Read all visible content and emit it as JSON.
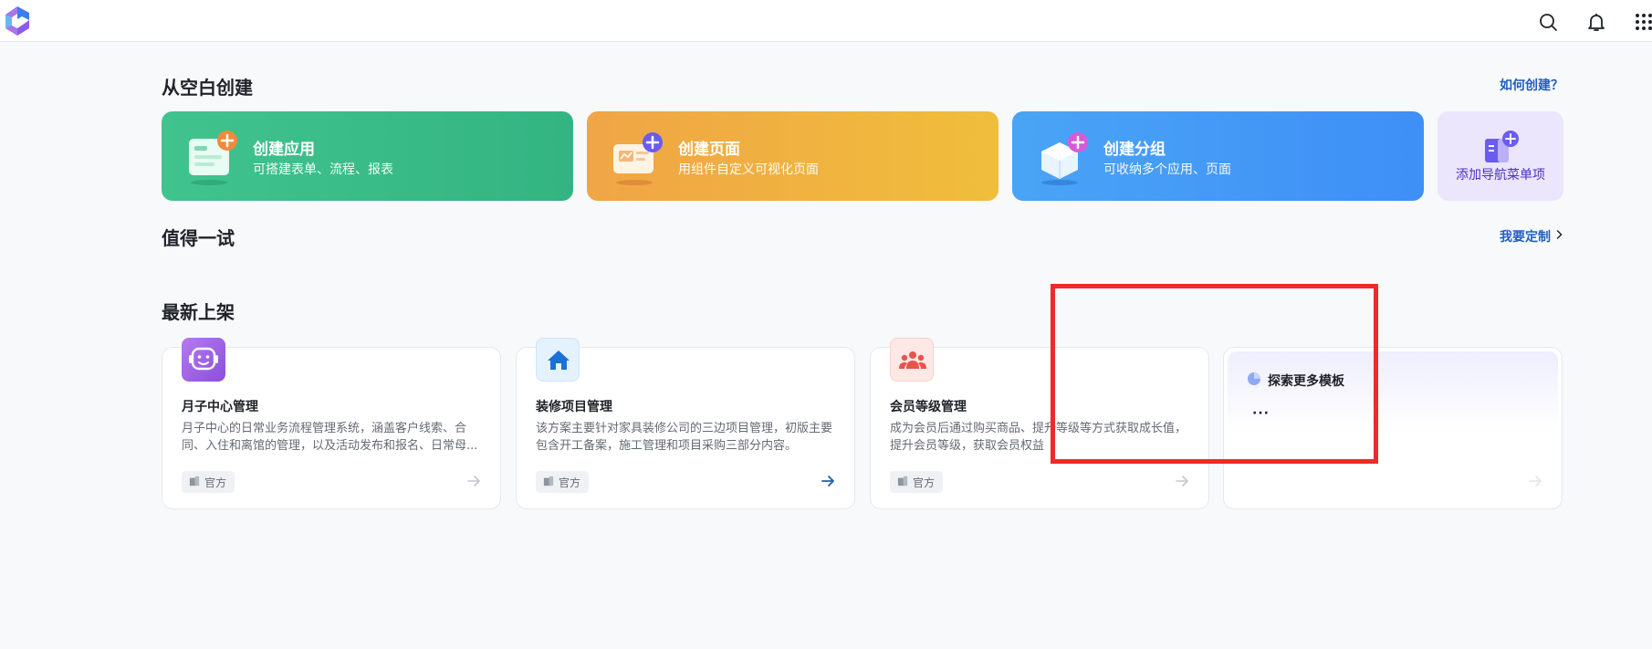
{
  "header": {
    "icons": [
      "search-icon",
      "bell-icon",
      "apps-grid-icon"
    ]
  },
  "blank_create": {
    "title": "从空白创建",
    "help_link": "如何创建？",
    "cards": [
      {
        "title": "创建应用",
        "subtitle": "可搭建表单、流程、报表",
        "color": "#3bbb88"
      },
      {
        "title": "创建页面",
        "subtitle": "用组件自定义可视化页面",
        "color": "#f0b040"
      },
      {
        "title": "创建分组",
        "subtitle": "可收纳多个应用、页面",
        "color": "#4499f6"
      }
    ],
    "nav_card": {
      "label": "添加导航菜单项"
    }
  },
  "try_section": {
    "title": "值得一试",
    "link": "我要定制"
  },
  "latest": {
    "title": "最新上架",
    "templates": [
      {
        "title": "月子中心管理",
        "desc": "月子中心的日常业务流程管理系统，涵盖客户线索、合同、入住和离馆的管理，以及活动发布和报名、日常母...",
        "badge": "官方",
        "icon": "robot-icon",
        "icon_color": "#9b5ce0"
      },
      {
        "title": "装修项目管理",
        "desc": "该方案主要针对家具装修公司的三边项目管理，初版主要包含开工备案，施工管理和项目采购三部分内容。",
        "badge": "官方",
        "icon": "house-icon",
        "icon_color": "#1a6fd8"
      },
      {
        "title": "会员等级管理",
        "desc": "成为会员后通过购买商品、提升等级等方式获取成长值，提升会员等级，获取会员权益",
        "badge": "官方",
        "icon": "people-icon",
        "icon_color": "#e8544a"
      }
    ],
    "explore": {
      "title": "探索更多模板",
      "dots": "···"
    }
  },
  "highlight_color": "#ee2a2a"
}
